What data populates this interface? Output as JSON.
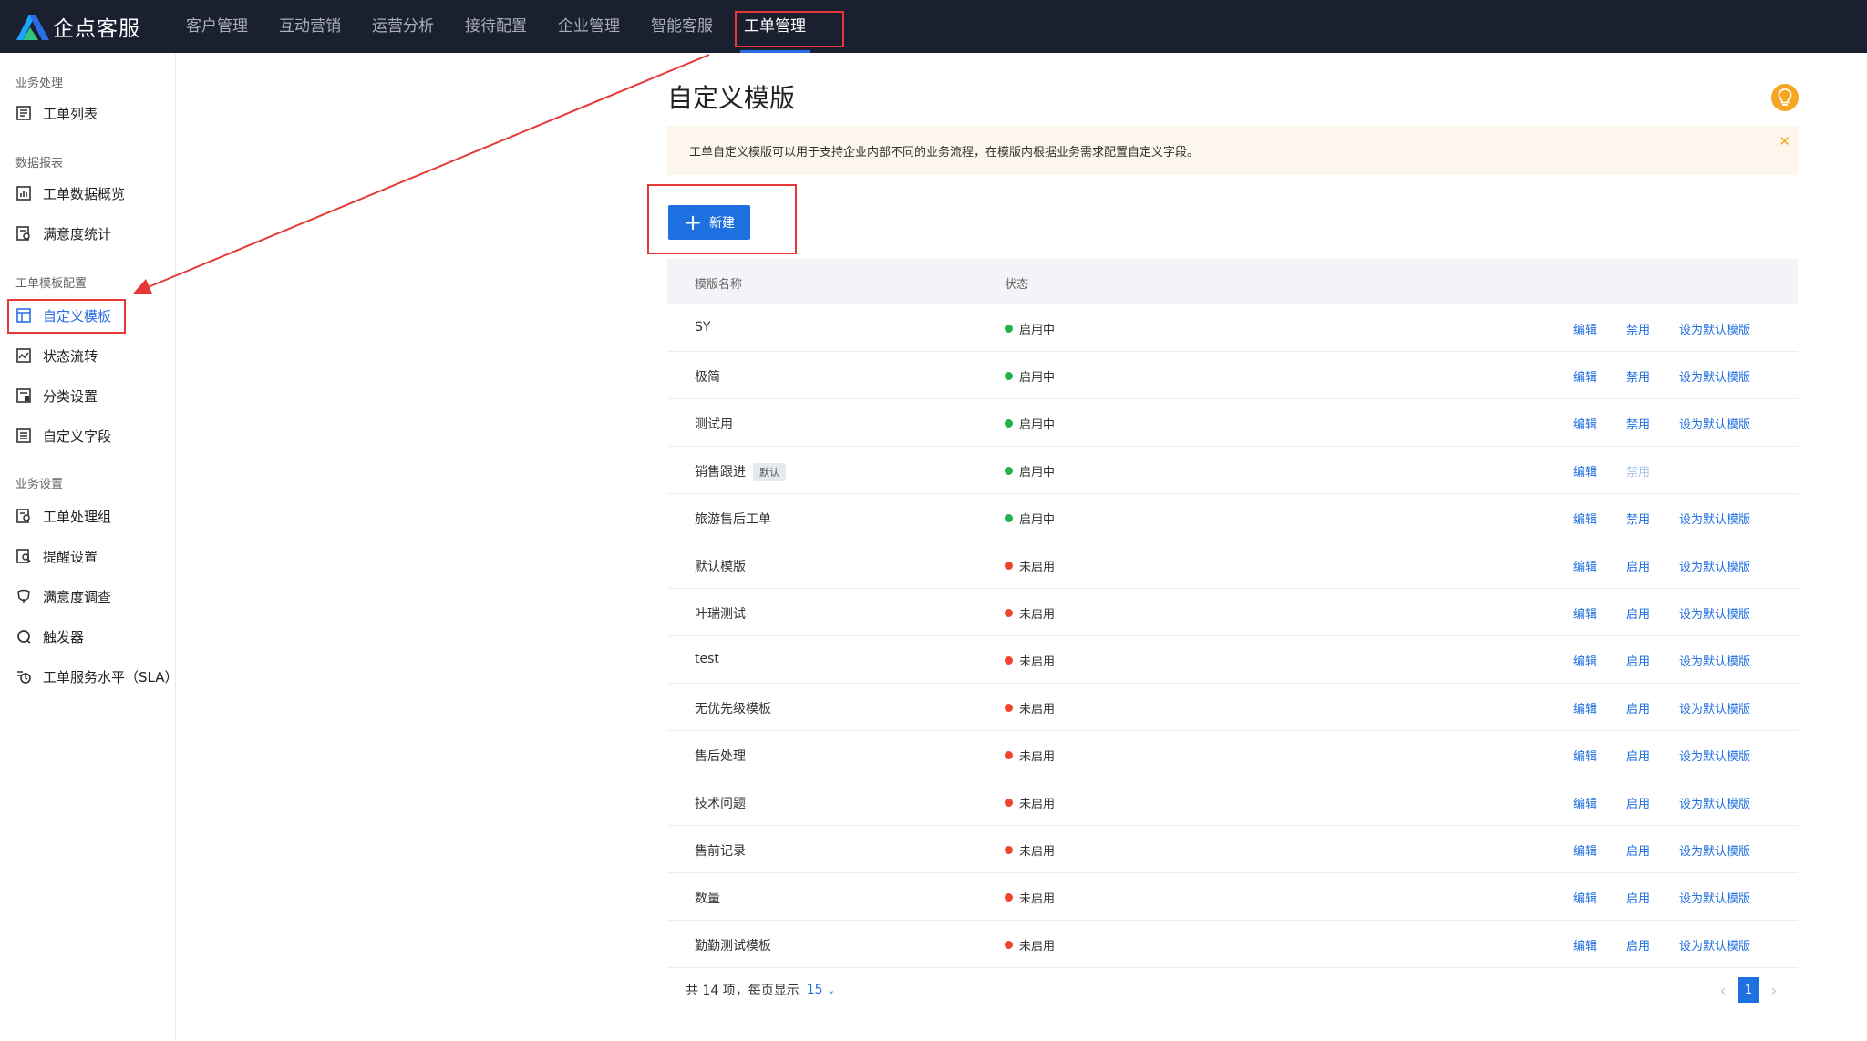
{
  "brand": {
    "name": "企点客服",
    "logo_icon": "triangle-logo-icon"
  },
  "nav": [
    {
      "label": "客户管理"
    },
    {
      "label": "互动营销"
    },
    {
      "label": "运营分析"
    },
    {
      "label": "接待配置"
    },
    {
      "label": "企业管理"
    },
    {
      "label": "智能客服"
    },
    {
      "label": "工单管理",
      "active": true
    }
  ],
  "sidebar": {
    "groups": [
      {
        "title": "业务处理",
        "items": [
          {
            "label": "工单列表",
            "icon": "list-icon"
          }
        ]
      },
      {
        "title": "数据报表",
        "items": [
          {
            "label": "工单数据概览",
            "icon": "bar-chart-icon"
          },
          {
            "label": "满意度统计",
            "icon": "report-icon"
          }
        ]
      },
      {
        "title": "工单模板配置",
        "items": [
          {
            "label": "自定义模板",
            "icon": "template-icon",
            "active": true
          },
          {
            "label": "状态流转",
            "icon": "trend-icon"
          },
          {
            "label": "分类设置",
            "icon": "category-icon"
          },
          {
            "label": "自定义字段",
            "icon": "field-icon"
          }
        ]
      },
      {
        "title": "业务设置",
        "items": [
          {
            "label": "工单处理组",
            "icon": "group-icon"
          },
          {
            "label": "提醒设置",
            "icon": "reminder-icon"
          },
          {
            "label": "满意度调查",
            "icon": "survey-icon"
          },
          {
            "label": "触发器",
            "icon": "trigger-icon"
          },
          {
            "label": "工单服务水平（SLA）",
            "icon": "sla-icon"
          }
        ]
      }
    ]
  },
  "main": {
    "title": "自定义模版",
    "notice": "工单自定义模版可以用于支持企业内部不同的业务流程，在模版内根据业务需求配置自定义字段。",
    "new_button": "新建",
    "columns": {
      "name": "模版名称",
      "status": "状态"
    },
    "actions": {
      "edit": "编辑",
      "disable": "禁用",
      "enable": "启用",
      "set_default": "设为默认模版"
    },
    "rows": [
      {
        "name": "SY",
        "status": "启用中",
        "enabled": true
      },
      {
        "name": "极简",
        "status": "启用中",
        "enabled": true
      },
      {
        "name": "测试用",
        "status": "启用中",
        "enabled": true
      },
      {
        "name": "销售跟进",
        "tag": "默认",
        "status": "启用中",
        "enabled": true,
        "is_default": true
      },
      {
        "name": "旅游售后工单",
        "status": "启用中",
        "enabled": true
      },
      {
        "name": "默认模版",
        "status": "未启用",
        "enabled": false
      },
      {
        "name": "叶瑞测试",
        "status": "未启用",
        "enabled": false
      },
      {
        "name": "test",
        "status": "未启用",
        "enabled": false
      },
      {
        "name": "无优先级模板",
        "status": "未启用",
        "enabled": false
      },
      {
        "name": "售后处理",
        "status": "未启用",
        "enabled": false
      },
      {
        "name": "技术问题",
        "status": "未启用",
        "enabled": false
      },
      {
        "name": "售前记录",
        "status": "未启用",
        "enabled": false
      },
      {
        "name": "数量",
        "status": "未启用",
        "enabled": false
      },
      {
        "name": "勤勤测试模板",
        "status": "未启用",
        "enabled": false
      }
    ],
    "pagination": {
      "summary": "共 14 项，每页显示",
      "page_size": "15",
      "current_page": "1"
    }
  },
  "colors": {
    "topbar": "#1b2030",
    "accent": "#1e6fe0",
    "enabled_dot": "#22b14c",
    "disabled_dot": "#f0442f",
    "highlight": "#e53935",
    "notice_bg": "#fdf6ec"
  }
}
